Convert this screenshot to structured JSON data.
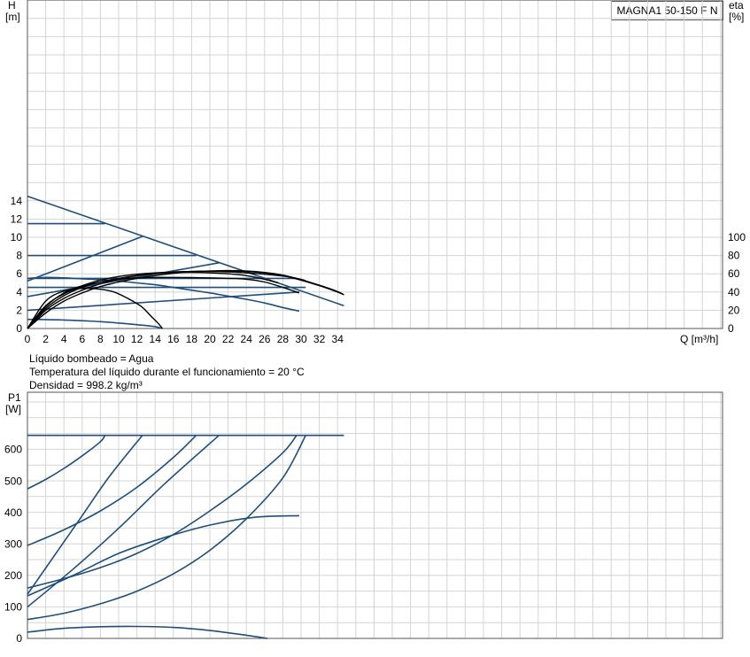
{
  "model_label": "MAGNA1 50-150 F N",
  "info_lines": [
    "Líquido bombeado = Agua",
    "Temperatura del líquido durante el funcionamiento = 20 °C",
    "Densidad = 998.2 kg/m³"
  ],
  "chart_data": [
    {
      "type": "line",
      "ylabel": "H",
      "yunit": "[m]",
      "y2label": "eta",
      "y2unit": "[%]",
      "xlabel": "Q [m³/h]",
      "xlim": [
        0,
        38
      ],
      "ylim": [
        0,
        18
      ],
      "y2lim": [
        0,
        180
      ],
      "x_ticks": [
        0,
        2,
        4,
        6,
        8,
        10,
        12,
        14,
        16,
        18,
        20,
        22,
        24,
        26,
        28,
        30,
        32,
        34
      ],
      "y_ticks": [
        0,
        2,
        4,
        6,
        8,
        10,
        12,
        14
      ],
      "y2_ticks": [
        0,
        20,
        40,
        60,
        80,
        100
      ],
      "grid": true,
      "series": [
        {
          "color": "#1f4e79",
          "x": [
            0,
            34.7
          ],
          "y": [
            14.5,
            2.5
          ]
        },
        {
          "color": "#1f4e79",
          "x": [
            0,
            8.5
          ],
          "y": [
            11.5,
            11.5
          ]
        },
        {
          "color": "#1f4e79",
          "x": [
            0,
            18.5
          ],
          "y": [
            8,
            8
          ]
        },
        {
          "color": "#1f4e79",
          "x": [
            0,
            29.5
          ],
          "y": [
            5.5,
            5.5
          ]
        },
        {
          "color": "#1f4e79",
          "x": [
            0,
            30.5
          ],
          "y": [
            4.5,
            4.5
          ]
        },
        {
          "color": "#1f4e79",
          "x": [
            0,
            12.6
          ],
          "y": [
            5.2,
            10.1
          ]
        },
        {
          "color": "#1f4e79",
          "x": [
            0,
            21
          ],
          "y": [
            3.5,
            7.2
          ]
        },
        {
          "color": "#1f4e79",
          "x": [
            0,
            29.8
          ],
          "y": [
            2,
            4
          ]
        },
        {
          "color": "#1f4e79",
          "x": [
            0,
            2,
            4,
            6,
            8,
            10,
            12,
            14,
            16,
            18,
            20,
            22,
            24,
            26,
            28,
            29.8
          ],
          "y": [
            5.5,
            5.6,
            5.55,
            5.45,
            5.35,
            5.2,
            5.0,
            4.8,
            4.5,
            4.2,
            3.9,
            3.55,
            3.2,
            2.8,
            2.3,
            1.9
          ]
        },
        {
          "color": "#1f4e79",
          "x": [
            0,
            2,
            4,
            6,
            8,
            10,
            12,
            14,
            14.8
          ],
          "y": [
            1.0,
            0.98,
            0.93,
            0.85,
            0.75,
            0.6,
            0.42,
            0.2,
            0.0
          ]
        },
        {
          "color": "#000000",
          "x": [
            0,
            2,
            4,
            6,
            8,
            9.5,
            11,
            12.5,
            13.5,
            14.3,
            14.8
          ],
          "y": [
            0,
            3.0,
            4.1,
            4.4,
            4.3,
            4.0,
            3.3,
            2.4,
            1.4,
            0.6,
            0
          ]
        },
        {
          "color": "#000000",
          "x": [
            0,
            2,
            4,
            6,
            8,
            10,
            12,
            14,
            16,
            18,
            20,
            22,
            24,
            26,
            28,
            29.8
          ],
          "y": [
            0,
            2.5,
            3.8,
            4.6,
            5.1,
            5.4,
            5.55,
            5.6,
            5.6,
            5.58,
            5.55,
            5.5,
            5.4,
            5.1,
            4.5,
            3.9
          ]
        },
        {
          "color": "#000000",
          "x": [
            0,
            2,
            4,
            6,
            8,
            10,
            12,
            14,
            16,
            18,
            20,
            22,
            24,
            26,
            27.5
          ],
          "y": [
            0,
            2.4,
            3.9,
            4.7,
            5.3,
            5.7,
            5.95,
            6.1,
            6.15,
            6.15,
            6.1,
            6.0,
            5.8,
            5.4,
            5.0
          ]
        },
        {
          "color": "#000000",
          "x": [
            0,
            2,
            4,
            6,
            8,
            10,
            12,
            14,
            16,
            18,
            20,
            22,
            24,
            26,
            28,
            29,
            30,
            30.5
          ],
          "y": [
            0,
            2.0,
            3.3,
            4.2,
            4.9,
            5.4,
            5.8,
            6.05,
            6.2,
            6.25,
            6.25,
            6.2,
            6.1,
            5.95,
            5.75,
            5.6,
            5.4,
            5.25
          ]
        },
        {
          "color": "#000000",
          "x": [
            0,
            2,
            4,
            6,
            8,
            10,
            12,
            14,
            16,
            18,
            20,
            22,
            24,
            26,
            28,
            30,
            32,
            34,
            34.7
          ],
          "y": [
            0,
            2.2,
            3.6,
            4.5,
            5.1,
            5.5,
            5.8,
            6.0,
            6.15,
            6.25,
            6.3,
            6.3,
            6.25,
            6.1,
            5.8,
            5.3,
            4.7,
            4.0,
            3.7
          ]
        },
        {
          "color": "#000000",
          "x": [
            0,
            2,
            4,
            6,
            8,
            10,
            12,
            14,
            16,
            18,
            20,
            22,
            24,
            26,
            28,
            30,
            32,
            34,
            34.7
          ],
          "y": [
            0,
            1.7,
            3.0,
            3.9,
            4.6,
            5.1,
            5.5,
            5.8,
            6.05,
            6.2,
            6.3,
            6.35,
            6.3,
            6.15,
            5.85,
            5.35,
            4.75,
            4.05,
            3.7
          ]
        }
      ]
    },
    {
      "type": "line",
      "ylabel": "P1",
      "yunit": "[W]",
      "xlim": [
        0,
        38
      ],
      "ylim": [
        0,
        800
      ],
      "y_ticks": [
        0,
        100,
        200,
        300,
        400,
        500,
        600
      ],
      "grid": true,
      "series": [
        {
          "color": "#1f4e79",
          "x": [
            0,
            34.7
          ],
          "y": [
            645,
            645
          ]
        },
        {
          "color": "#1f4e79",
          "x": [
            0,
            2,
            4,
            6,
            8,
            8.5
          ],
          "y": [
            475,
            505,
            540,
            580,
            625,
            645
          ]
        },
        {
          "color": "#1f4e79",
          "x": [
            0,
            4,
            8,
            12,
            16,
            18.5
          ],
          "y": [
            295,
            345,
            405,
            480,
            575,
            645
          ]
        },
        {
          "color": "#1f4e79",
          "x": [
            0,
            4,
            8,
            12,
            16,
            20,
            24,
            28,
            29.5
          ],
          "y": [
            160,
            190,
            225,
            270,
            330,
            405,
            490,
            590,
            645
          ]
        },
        {
          "color": "#1f4e79",
          "x": [
            0,
            4,
            8,
            12,
            16,
            20,
            24,
            28,
            30.5
          ],
          "y": [
            60,
            80,
            110,
            150,
            205,
            280,
            380,
            510,
            645
          ]
        },
        {
          "color": "#1f4e79",
          "x": [
            0,
            3,
            6,
            9,
            12.6
          ],
          "y": [
            140,
            265,
            390,
            515,
            645
          ]
        },
        {
          "color": "#1f4e79",
          "x": [
            0,
            5,
            10,
            15,
            21
          ],
          "y": [
            100,
            220,
            350,
            490,
            645
          ]
        },
        {
          "color": "#1f4e79",
          "x": [
            0,
            5,
            10,
            15,
            20,
            25,
            29.8
          ],
          "y": [
            135,
            200,
            270,
            320,
            360,
            385,
            390
          ]
        },
        {
          "color": "#1f4e79",
          "x": [
            0,
            4,
            8,
            12,
            16,
            20,
            24,
            26.3
          ],
          "y": [
            20,
            32,
            37,
            38,
            35,
            25,
            10,
            0
          ]
        }
      ]
    }
  ]
}
